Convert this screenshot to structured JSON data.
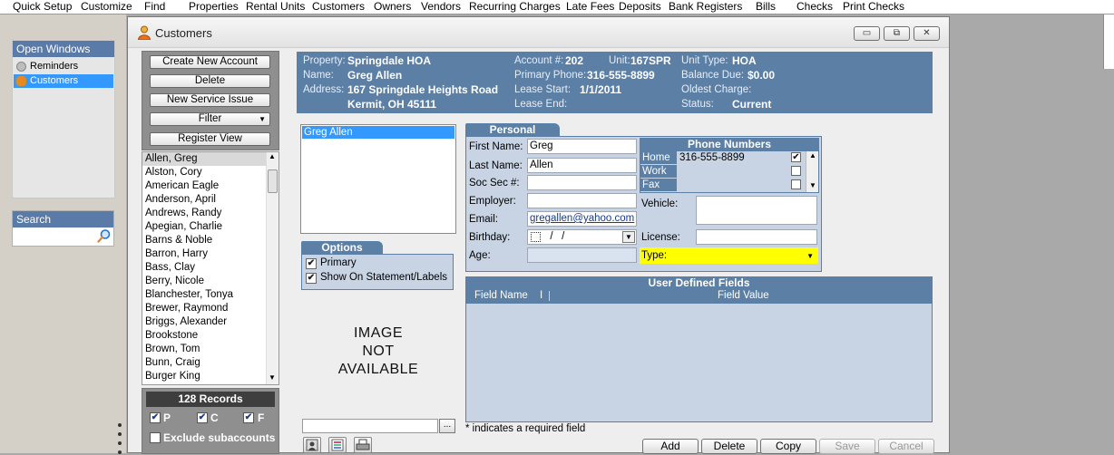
{
  "menu": [
    "Quick Setup",
    "Customize",
    "Find",
    "Properties",
    "Rental Units",
    "Customers",
    "Owners",
    "Vendors",
    "Recurring Charges",
    "Late Fees",
    "Deposits",
    "Bank Registers",
    "Bills",
    "Checks",
    "Print Checks"
  ],
  "dock": {
    "open_windows_label": "Open Windows",
    "windows": [
      "Reminders",
      "Customers"
    ],
    "search_label": "Search",
    "search_value": ""
  },
  "window": {
    "title": "Customers",
    "controls": {
      "minimize": "▭",
      "restore": "⧉",
      "close": "✕"
    }
  },
  "commands": [
    "Create New Account",
    "Delete",
    "New Service Issue",
    "Filter",
    "Register View"
  ],
  "customers": [
    "Allen, Greg",
    "Alston, Cory",
    "American Eagle",
    "Anderson, April",
    "Andrews, Randy",
    "Apegian, Charlie",
    "Barns & Noble",
    "Barron, Harry",
    "Bass, Clay",
    "Berry, Nicole",
    "Blanchester, Tonya",
    "Brewer, Raymond",
    "Briggs, Alexander",
    "Brookstone",
    "Brown, Tom",
    "Bunn, Craig",
    "Burger King"
  ],
  "records": {
    "count_label": "128 Records",
    "filters": [
      {
        "label": "P",
        "checked": true
      },
      {
        "label": "C",
        "checked": true
      },
      {
        "label": "F",
        "checked": true
      }
    ],
    "exclude_label": "Exclude subaccounts"
  },
  "info": {
    "property_label": "Property:",
    "property": "Springdale HOA",
    "name_label": "Name:",
    "name": "Greg Allen",
    "address_label": "Address:",
    "address1": "167 Springdale Heights Road",
    "address2": "Kermit, OH 45111",
    "account_label": "Account #:",
    "account": "202",
    "unit_label": "Unit:",
    "unit": "167SPR",
    "phone_label": "Primary Phone:",
    "phone": "316-555-8899",
    "lease_start_label": "Lease Start:",
    "lease_start": "1/1/2011",
    "lease_end_label": "Lease End:",
    "lease_end": "",
    "unit_type_label": "Unit Type:",
    "unit_type": "HOA",
    "balance_label": "Balance Due:",
    "balance": "$0.00",
    "oldest_label": "Oldest Charge:",
    "oldest": "",
    "status_label": "Status:",
    "status": "Current"
  },
  "names_list": [
    "Greg Allen"
  ],
  "options": {
    "title": "Options",
    "primary_label": "Primary",
    "statement_label": "Show On Statement/Labels"
  },
  "no_image": [
    "IMAGE",
    "NOT",
    "AVAILABLE"
  ],
  "personal": {
    "title": "Personal",
    "first_name_label": "First Name:",
    "first_name": "Greg",
    "last_name_label": "Last Name:",
    "last_name": "Allen",
    "ssn_label": "Soc Sec #:",
    "ssn": "",
    "employer_label": "Employer:",
    "employer": "",
    "email_label": "Email:",
    "email": "gregallen@yahoo.com",
    "birthday_label": "Birthday:",
    "birthday": "  /   /",
    "age_label": "Age:",
    "age": "",
    "vehicle_label": "Vehicle:",
    "vehicle": "",
    "license_label": "License:",
    "license": "",
    "type_label": "Type:",
    "type": ""
  },
  "phones": {
    "title": "Phone Numbers",
    "rows": [
      {
        "label": "Home",
        "number": "316-555-8899",
        "checked": true
      },
      {
        "label": "Work",
        "number": "",
        "checked": false
      },
      {
        "label": "Fax",
        "number": "",
        "checked": false
      }
    ]
  },
  "udf": {
    "title": "User Defined Fields",
    "col_name": "Field Name",
    "col_sep": "I",
    "col_value": "Field Value"
  },
  "required_note": "* indicates a required field",
  "buttons": {
    "add": "Add",
    "delete": "Delete",
    "copy": "Copy",
    "save": "Save",
    "cancel": "Cancel"
  },
  "colors": {
    "accent": "#5c7fa6",
    "highlight": "#ffff00",
    "selection": "#3399ff"
  }
}
